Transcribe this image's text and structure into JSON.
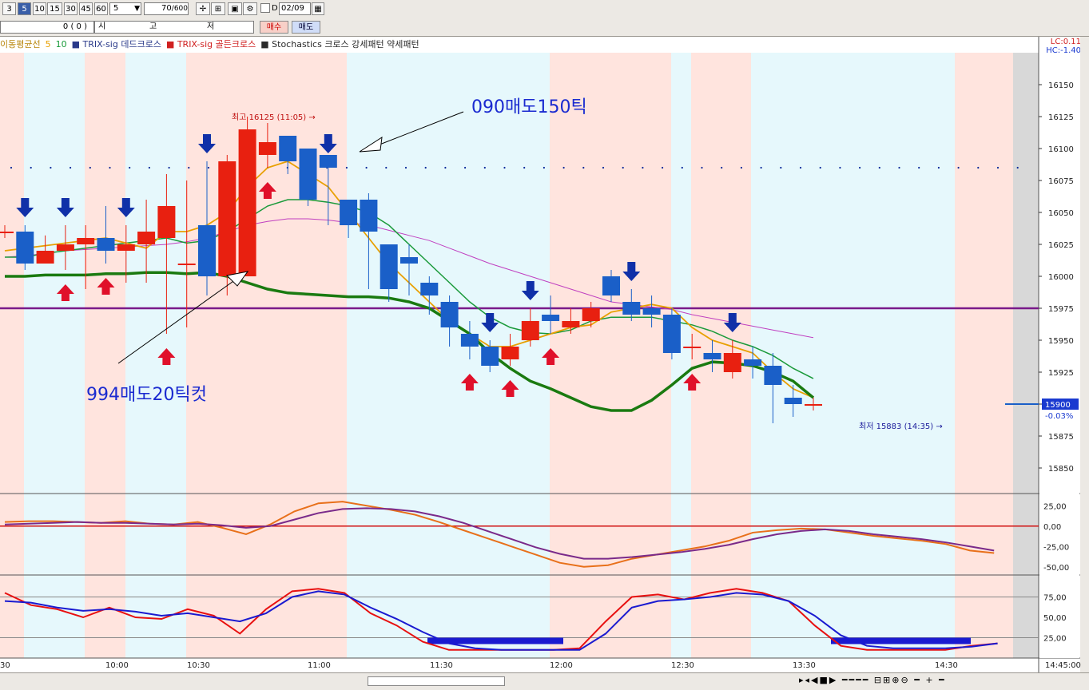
{
  "toolbar": {
    "periods": [
      "3",
      "5",
      "10",
      "15",
      "30",
      "45",
      "60"
    ],
    "selected_period": "5",
    "interval_value": "5",
    "count_value": "70",
    "count_total": "/600",
    "date_value": "02/09",
    "checkbox_label": "D"
  },
  "toolbar2": {
    "price_value": "0 (   0 )",
    "label_open": "시",
    "label_high": "고",
    "label_low": "저",
    "buy_label": "매수",
    "sell_label": "매도"
  },
  "legend": {
    "items": [
      {
        "label": "이동평균선",
        "color": "#b8860b"
      },
      {
        "label": "5",
        "color": "#e8a000"
      },
      {
        "label": "10",
        "color": "#1a9a3a"
      },
      {
        "label": "■ TRIX-sig 데드크로스",
        "color": "#2a3a8a"
      },
      {
        "label": "■ TRIX-sig 골든크로스",
        "color": "#d02020"
      },
      {
        "label": "■ Stochastics 크로스 강세패턴  약세패턴",
        "color": "#2a2a2a"
      }
    ]
  },
  "lc_label": "LC:0.11",
  "hc_label": "HC:-1.40",
  "annotations": {
    "high_label": "최고 16125 (11:05) →",
    "low_label": "최저 15883 (14:35) →",
    "note1": "090매도150틱",
    "note2": "994매도20틱컷"
  },
  "current_price": "15900",
  "current_change": "-0.03%",
  "colors": {
    "up": "#e82010",
    "down": "#1a5fc8",
    "ma5": "#e8a000",
    "ma10": "#1a9a3a",
    "ma_long": "#c040c0",
    "ma_thick": "#1a7a10",
    "hline": "#7a1a8a",
    "bg_blue": "#e6f8fc",
    "bg_pink": "#ffe4de"
  },
  "chart_data": [
    {
      "type": "candlestick",
      "name": "price",
      "ylim": [
        15830,
        16175
      ],
      "yticks": [
        15850,
        15875,
        15900,
        15925,
        15950,
        15975,
        16000,
        16025,
        16050,
        16075,
        16100,
        16125,
        16150
      ],
      "xtick_labels": [
        "30",
        "10:00",
        "10:30",
        "11:00",
        "11:30",
        "12:00",
        "12:30",
        "13:30",
        "14:30",
        "14:45:00"
      ],
      "hline": 15975,
      "open": [
        16035,
        16035,
        16010,
        16020,
        16025,
        16030,
        16020,
        16025,
        16030,
        16010,
        16040,
        16000,
        16000,
        16095,
        16110,
        16100,
        16095,
        16060,
        16060,
        16025,
        16015,
        15995,
        15980,
        15955,
        15945,
        15935,
        15950,
        15970,
        15960,
        15965,
        16000,
        15980,
        15975,
        15970,
        15945,
        15940,
        15925,
        15935,
        15930,
        15905,
        15900
      ],
      "close": [
        16035,
        16010,
        16020,
        16025,
        16030,
        16020,
        16025,
        16035,
        16055,
        16010,
        16000,
        16090,
        16115,
        16105,
        16090,
        16060,
        16085,
        16040,
        16035,
        15990,
        16010,
        15985,
        15960,
        15945,
        15930,
        15945,
        15965,
        15965,
        15965,
        15975,
        15985,
        15970,
        15970,
        15940,
        15945,
        15935,
        15940,
        15930,
        15915,
        15900,
        15900
      ],
      "high": [
        16040,
        16040,
        16032,
        16040,
        16040,
        16055,
        16040,
        16060,
        16080,
        16075,
        16090,
        16095,
        16125,
        16120,
        16110,
        16090,
        16090,
        16060,
        16065,
        16015,
        16025,
        16000,
        15985,
        15965,
        15950,
        15955,
        15975,
        15985,
        15975,
        15980,
        16005,
        15990,
        15985,
        15975,
        15955,
        15950,
        15950,
        15945,
        15940,
        15915,
        15905
      ],
      "low": [
        16030,
        16005,
        16010,
        16005,
        15990,
        16010,
        15995,
        15995,
        15955,
        15960,
        15985,
        15985,
        16080,
        16085,
        16080,
        16055,
        16040,
        16030,
        15990,
        15980,
        15985,
        15970,
        15945,
        15935,
        15925,
        15930,
        15945,
        15955,
        15955,
        15960,
        15980,
        15965,
        15960,
        15935,
        15935,
        15925,
        15920,
        15920,
        15885,
        15890,
        15895
      ],
      "ma5": [
        16020,
        16022,
        16024,
        16026,
        16028,
        16030,
        16026,
        16022,
        16035,
        16035,
        16040,
        16050,
        16070,
        16085,
        16090,
        16080,
        16070,
        16050,
        16030,
        16010,
        15995,
        15980,
        15965,
        15955,
        15945,
        15945,
        15950,
        15955,
        15960,
        15962,
        15972,
        15975,
        15978,
        15975,
        15960,
        15950,
        15945,
        15940,
        15925,
        15912,
        15905
      ],
      "ma10": [
        16015,
        16015,
        16018,
        16020,
        16022,
        16024,
        16026,
        16028,
        16030,
        16026,
        16028,
        16035,
        16045,
        16055,
        16060,
        16060,
        16058,
        16055,
        16050,
        16040,
        16025,
        16010,
        15995,
        15980,
        15968,
        15960,
        15956,
        15955,
        15958,
        15965,
        15968,
        15968,
        15968,
        15965,
        15962,
        15957,
        15950,
        15945,
        15938,
        15928,
        15920
      ],
      "ma_long": [
        16015,
        16016,
        16018,
        16020,
        16021,
        16022,
        16023,
        16024,
        16025,
        16027,
        16030,
        16035,
        16040,
        16043,
        16045,
        16045,
        16044,
        16042,
        16040,
        16036,
        16032,
        16028,
        16022,
        16016,
        16010,
        16005,
        16000,
        15995,
        15990,
        15985,
        15980,
        15978,
        15976,
        15974,
        15970,
        15967,
        15964,
        15961,
        15958,
        15955,
        15952
      ],
      "ma_thick": [
        16000,
        16000,
        16001,
        16001,
        16001,
        16002,
        16002,
        16003,
        16003,
        16002,
        16003,
        16000,
        15995,
        15990,
        15987,
        15986,
        15985,
        15984,
        15984,
        15983,
        15980,
        15975,
        15965,
        15955,
        15940,
        15928,
        15918,
        15912,
        15905,
        15898,
        15895,
        15895,
        15903,
        15915,
        15928,
        15933,
        15932,
        15930,
        15925,
        15918,
        15905
      ],
      "signals_up": [
        3,
        5,
        8,
        13,
        23,
        25,
        27,
        34,
        43,
        47
      ],
      "signals_down": [
        1,
        3,
        6,
        10,
        16,
        24,
        26,
        31,
        36,
        45
      ]
    },
    {
      "type": "line",
      "name": "TRIX",
      "yticks": [
        25,
        0,
        -25,
        -50
      ],
      "ylim": [
        -60,
        38
      ],
      "series": [
        {
          "color": "#e8701a",
          "values": [
            5,
            6,
            6,
            5,
            4,
            6,
            3,
            2,
            5,
            -2,
            -10,
            2,
            18,
            28,
            30,
            25,
            20,
            14,
            5,
            -5,
            -15,
            -25,
            -35,
            -45,
            -50,
            -48,
            -40,
            -35,
            -30,
            -25,
            -18,
            -8,
            -5,
            -3,
            -4,
            -8,
            -12,
            -15,
            -18,
            -22,
            -30,
            -33
          ]
        },
        {
          "color": "#7a2a8a",
          "values": [
            2,
            3,
            4,
            5,
            4,
            4,
            3,
            2,
            3,
            1,
            -2,
            0,
            8,
            16,
            21,
            22,
            21,
            18,
            12,
            4,
            -6,
            -16,
            -26,
            -34,
            -40,
            -40,
            -38,
            -35,
            -32,
            -28,
            -23,
            -16,
            -10,
            -6,
            -4,
            -6,
            -10,
            -13,
            -16,
            -20,
            -25,
            -30
          ]
        }
      ]
    },
    {
      "type": "line",
      "name": "Stochastics",
      "yticks": [
        75,
        50,
        25
      ],
      "ylim": [
        0,
        100
      ],
      "series": [
        {
          "color": "#e81010",
          "values": [
            80,
            65,
            60,
            50,
            62,
            50,
            48,
            60,
            52,
            30,
            60,
            82,
            85,
            80,
            55,
            40,
            20,
            10,
            10,
            10,
            10,
            10,
            12,
            45,
            75,
            78,
            72,
            80,
            85,
            80,
            70,
            40,
            15,
            10,
            10,
            10,
            10,
            15,
            18
          ]
        },
        {
          "color": "#1a1ad0",
          "values": [
            70,
            68,
            62,
            58,
            60,
            57,
            52,
            55,
            50,
            45,
            55,
            75,
            82,
            78,
            62,
            48,
            32,
            18,
            12,
            10,
            10,
            10,
            10,
            30,
            62,
            70,
            72,
            75,
            80,
            78,
            70,
            52,
            28,
            15,
            12,
            12,
            12,
            14,
            18
          ]
        }
      ]
    }
  ]
}
